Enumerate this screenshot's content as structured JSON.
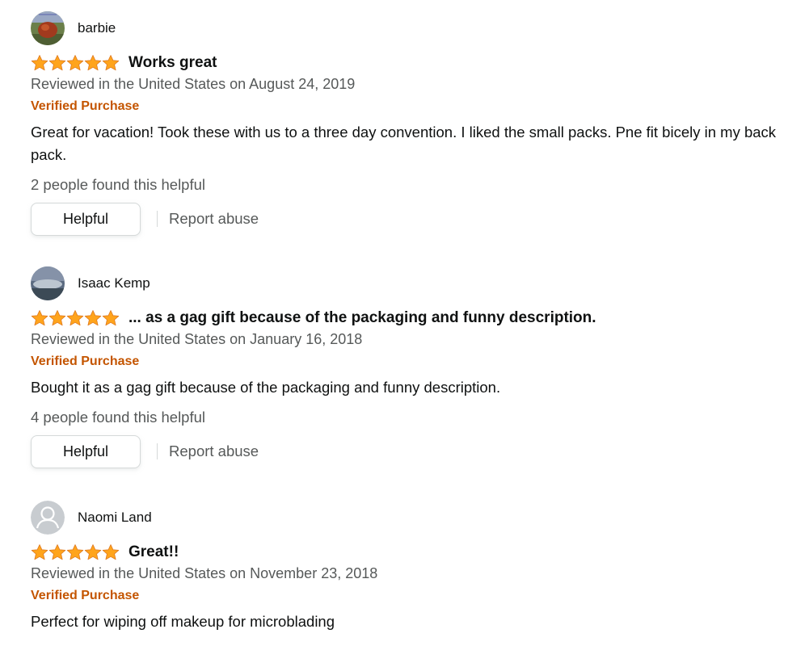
{
  "reviews": [
    {
      "profile_name": "barbie",
      "rating": 5,
      "title": "Works great",
      "date": "Reviewed in the United States on August 24, 2019",
      "verified": "Verified Purchase",
      "body": "Great for vacation! Took these with us to a three day convention. I liked the small packs. Pne fit bicely in my back pack.",
      "helpful_count": "2 people found this helpful",
      "helpful_label": "Helpful",
      "report_label": "Report abuse"
    },
    {
      "profile_name": "Isaac Kemp",
      "rating": 5,
      "title": "... as a gag gift because of the packaging and funny description.",
      "date": "Reviewed in the United States on January 16, 2018",
      "verified": "Verified Purchase",
      "body": "Bought it as a gag gift because of the packaging and funny description.",
      "helpful_count": "4 people found this helpful",
      "helpful_label": "Helpful",
      "report_label": "Report abuse"
    },
    {
      "profile_name": "Naomi Land",
      "rating": 5,
      "title": "Great!!",
      "date": "Reviewed in the United States on November 23, 2018",
      "verified": "Verified Purchase",
      "body": "Perfect for wiping off makeup for microblading"
    }
  ],
  "colors": {
    "star_fill": "#ffa41c",
    "star_stroke": "#de7921",
    "verified": "#c45500",
    "secondary_text": "#565959"
  }
}
